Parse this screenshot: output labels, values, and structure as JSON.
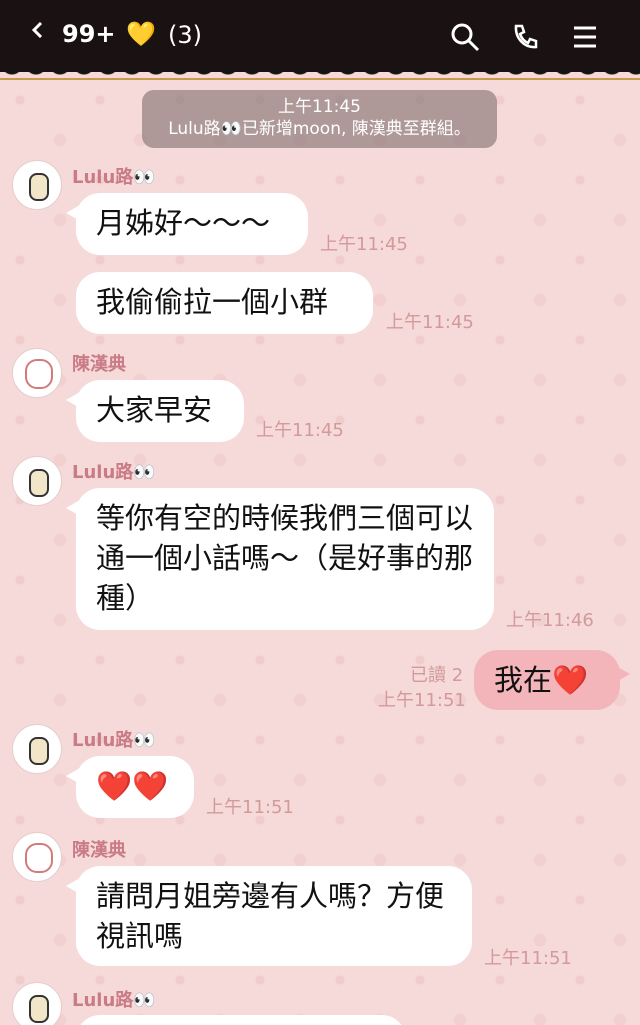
{
  "header": {
    "unread": "99+",
    "heart": "💛",
    "count": "(3)"
  },
  "system": {
    "time": "上午11:45",
    "text": "Lulu路👀已新增moon, 陳漢典至群組。"
  },
  "messages": {
    "m1": {
      "sender": "Lulu路👀",
      "text": "月姊好～～～",
      "time": "上午11:45"
    },
    "m2": {
      "text": "我偷偷拉一個小群",
      "time": "上午11:45"
    },
    "m3": {
      "sender": "陳漢典",
      "text": "大家早安",
      "time": "上午11:45"
    },
    "m4": {
      "sender": "Lulu路👀",
      "text": "等你有空的時候我們三個可以通一個小話嗎～（是好事的那種）",
      "time": "上午11:46"
    },
    "m5": {
      "read": "已讀 2",
      "time": "上午11:51",
      "text": "我在",
      "heart": "❤️"
    },
    "m6": {
      "sender": "Lulu路👀",
      "text": "❤️❤️",
      "time": "上午11:51"
    },
    "m7": {
      "sender": "陳漢典",
      "text": "請問月姐旁邊有人嗎？方便視訊嗎",
      "time": "上午11:51"
    },
    "m8": {
      "sender": "Lulu路👀"
    }
  },
  "colors": {
    "header_bg": "#1a1212",
    "chat_bg": "#f6d9d9",
    "mine_bubble": "#f3b5b9",
    "sender_name": "#c97b86",
    "timestamp": "#d29a9a"
  }
}
